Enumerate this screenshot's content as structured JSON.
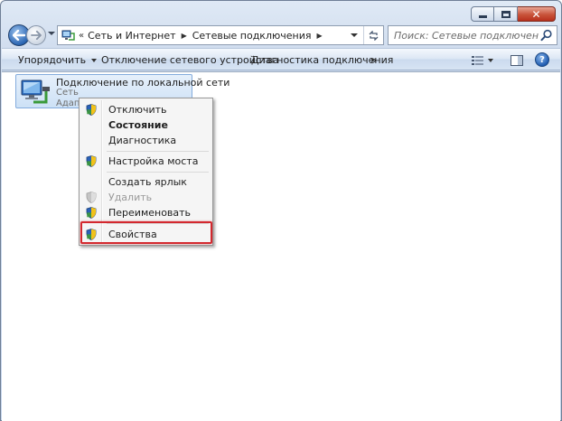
{
  "window": {
    "accent_color": "#2b66b3",
    "close_color": "#c8533a"
  },
  "caption_buttons": {
    "minimize_icon": "minimize-icon",
    "maximize_icon": "maximize-icon",
    "close_label": "✕"
  },
  "nav": {
    "back_icon": "back-arrow-icon",
    "forward_icon": "forward-arrow-icon"
  },
  "address": {
    "chevron": "«",
    "crumbs": [
      "Сеть и Интернет",
      "Сетевые подключения"
    ],
    "refresh_icon": "refresh-icon"
  },
  "search": {
    "placeholder": "Поиск: Сетевые подключения"
  },
  "toolbar": {
    "organize": "Упорядочить",
    "disable_device": "Отключение сетевого устройства",
    "diagnose": "Диагностика подключения",
    "more": "»"
  },
  "connection": {
    "name": "Подключение по локальной сети",
    "status": "Сеть",
    "adapter": "Адапте"
  },
  "context_menu": {
    "items": [
      {
        "label": "Отключить",
        "shield": true
      },
      {
        "label": "Состояние",
        "shield": false,
        "bold": true
      },
      {
        "label": "Диагностика",
        "shield": false
      },
      {
        "label": "Настройка моста",
        "shield": true
      },
      {
        "label": "Создать ярлык",
        "shield": false
      },
      {
        "label": "Удалить",
        "shield": true,
        "disabled": true
      },
      {
        "label": "Переименовать",
        "shield": true
      },
      {
        "label": "Свойства",
        "shield": true
      }
    ]
  },
  "highlight": {
    "color": "#d3282e"
  }
}
